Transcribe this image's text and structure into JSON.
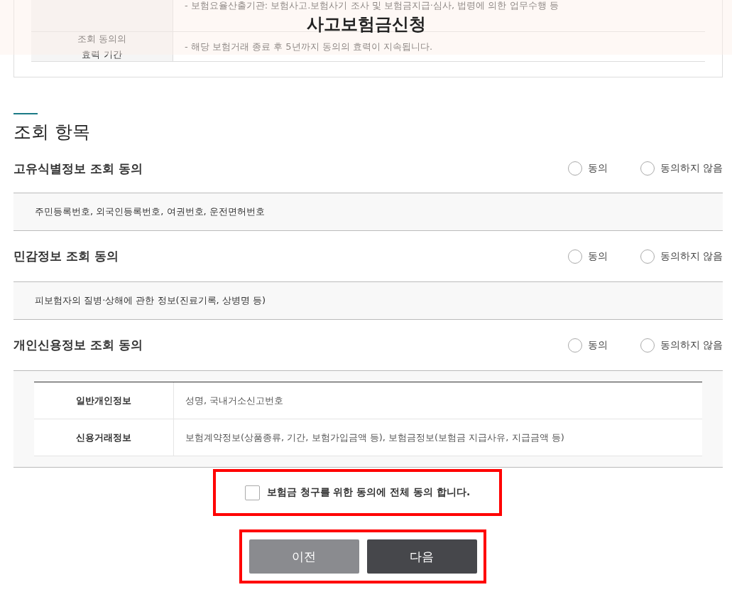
{
  "header": {
    "title": "사고보험금신청"
  },
  "prior_table": {
    "rows": [
      {
        "label_lines": [],
        "content": "- 보험요율산출기관: 보험사고.보험사기 조사 및 보험금지급·심사, 법령에 의한 업무수행 등"
      },
      {
        "label_lines": [
          "조회 동의의",
          "효력 기간"
        ],
        "content": "- 해당 보험거래 종료 후 5년까지 동의의 효력이 지속됩니다."
      }
    ]
  },
  "section": {
    "title": "조회 항목"
  },
  "consents": [
    {
      "title": "고유식별정보 조회 동의",
      "options": [
        {
          "label": "동의",
          "selected": false
        },
        {
          "label": "동의하지 않음",
          "selected": false
        }
      ],
      "detail": {
        "kind": "text",
        "text": "주민등록번호, 외국인등록번호, 여권번호, 운전면허번호"
      }
    },
    {
      "title": "민감정보 조회 동의",
      "options": [
        {
          "label": "동의",
          "selected": false
        },
        {
          "label": "동의하지 않음",
          "selected": false
        }
      ],
      "detail": {
        "kind": "text",
        "text": "피보험자의 질병·상해에 관한 정보(진료기록, 상병명 등)"
      }
    },
    {
      "title": "개인신용정보 조회 동의",
      "options": [
        {
          "label": "동의",
          "selected": false
        },
        {
          "label": "동의하지 않음",
          "selected": false
        }
      ],
      "detail": {
        "kind": "table",
        "rows": [
          {
            "label": "일반개인정보",
            "value": "성명, 국내거소신고번호"
          },
          {
            "label": "신용거래정보",
            "value": "보험계약정보(상품종류, 기간, 보험가입금액 등), 보험금정보(보험금 지급사유, 지급금액 등)"
          }
        ]
      }
    }
  ],
  "agree_all": {
    "label": "보험금 청구를 위한 동의에 전체 동의 합니다.",
    "checked": false,
    "highlighted": true
  },
  "buttons": {
    "highlighted": true,
    "items": [
      {
        "label": "이전",
        "kind": "secondary"
      },
      {
        "label": "다음",
        "kind": "primary"
      }
    ]
  }
}
